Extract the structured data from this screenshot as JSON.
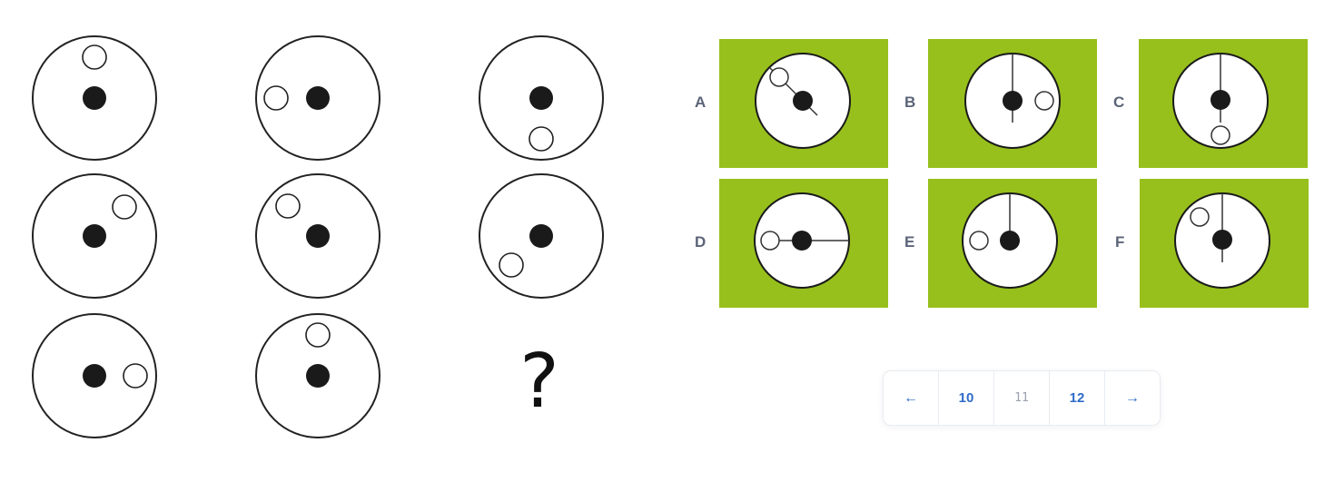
{
  "puzzle": {
    "question_mark": "?",
    "colors": {
      "stroke": "#222222",
      "fill_dot": "#1a1a1a",
      "background": "#ffffff"
    }
  },
  "options": {
    "tile_color": "#97c01d",
    "items": [
      {
        "label": "A"
      },
      {
        "label": "B"
      },
      {
        "label": "C"
      },
      {
        "label": "D"
      },
      {
        "label": "E"
      },
      {
        "label": "F"
      }
    ]
  },
  "pagination": {
    "prev_icon": "←",
    "pages": [
      "10",
      "11",
      "12"
    ],
    "current_page": "11",
    "next_icon": "→",
    "accent": "#2f6cc9"
  }
}
